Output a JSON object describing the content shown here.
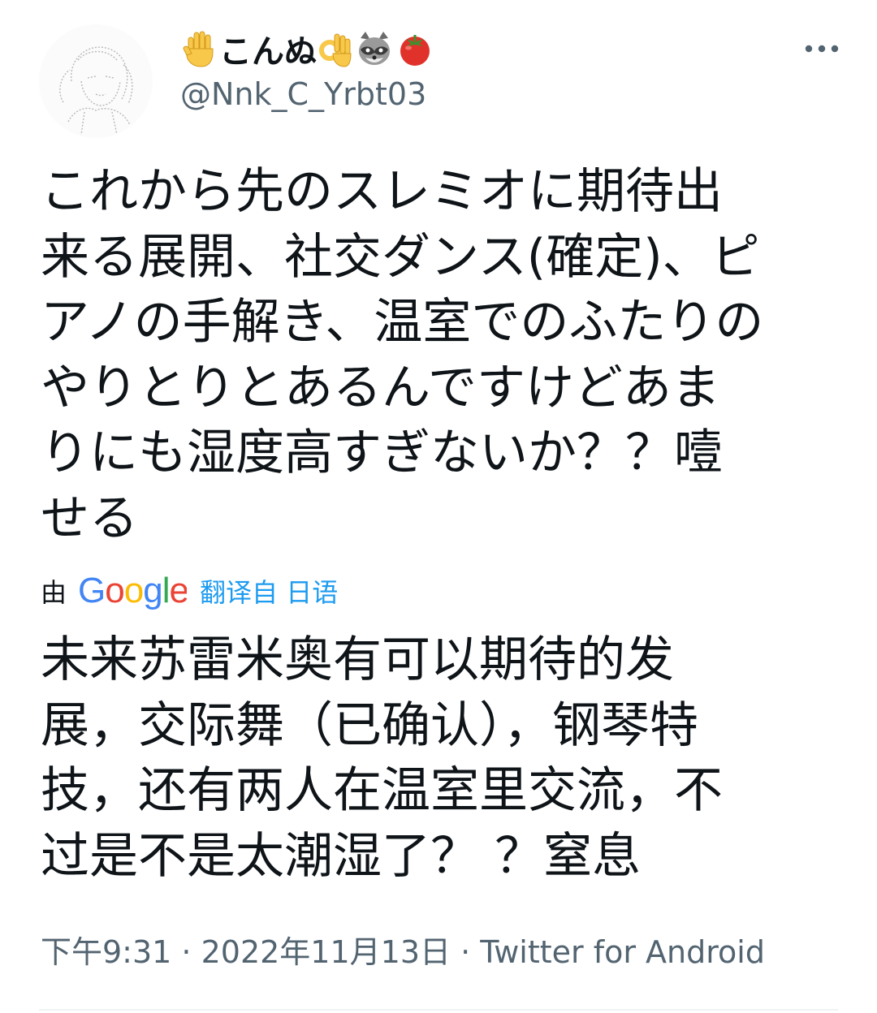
{
  "author": {
    "display_name_parts": [
      "✋",
      "こんぬ",
      "👌",
      "🦝",
      "🍅"
    ],
    "handle": "@Nnk_C_Yrbt03"
  },
  "tweet": {
    "text": "これから先のスレミオに期待出\n来る展開、社交ダンス(確定)、ピ\nアノの手解き、温室でのふたりの\nやりとりとあるんですけどあま\nりにも湿度高すぎないか？？噎\nせる"
  },
  "translation": {
    "by_label": "由",
    "google_logo_text": "Google",
    "link_label": "翻译自 日语",
    "text": "未来苏雷米奥有可以期待的发\n展，交际舞（已确认），钢琴特\n技，还有两人在温室里交流，不\n过是不是太潮湿了？ ？窒息"
  },
  "meta": {
    "time": "下午9:31",
    "separator": " · ",
    "date": "2022年11月13日",
    "source": "Twitter for Android"
  },
  "icons": {
    "more": "more-horizontal-icon",
    "avatar": "avatar-sketch"
  },
  "colors": {
    "text": "#0f1419",
    "secondary": "#536471",
    "link": "#1d9bf0",
    "google_blue": "#4285F4",
    "google_red": "#EA4335",
    "google_yellow": "#FBBC05",
    "google_green": "#34A853"
  }
}
